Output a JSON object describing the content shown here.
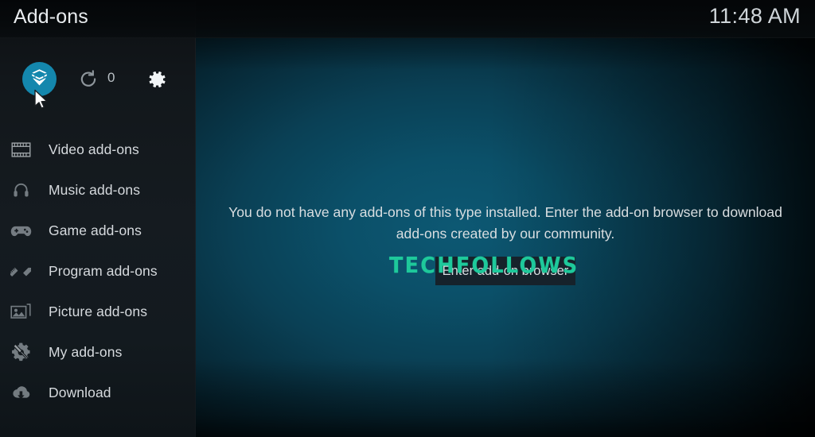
{
  "header": {
    "title": "Add-ons",
    "clock": "11:48 AM"
  },
  "toolbar": {
    "box_icon": "open-box-icon",
    "refresh_icon": "refresh-icon",
    "update_count": "0",
    "settings_icon": "gear-icon"
  },
  "sidebar": {
    "items": [
      {
        "label": "Video add-ons",
        "icon": "film-strip-icon"
      },
      {
        "label": "Music add-ons",
        "icon": "headphones-icon"
      },
      {
        "label": "Game add-ons",
        "icon": "gamepad-icon"
      },
      {
        "label": "Program add-ons",
        "icon": "pencil-ruler-icon"
      },
      {
        "label": "Picture add-ons",
        "icon": "picture-icon"
      },
      {
        "label": "My add-ons",
        "icon": "gear-screwdriver-icon"
      },
      {
        "label": "Download",
        "icon": "cloud-download-icon"
      }
    ]
  },
  "main": {
    "empty_message": "You do not have any add-ons of this type installed. Enter the add-on browser to download add-ons created by our community.",
    "browser_button": "Enter add-on browser"
  },
  "watermark": {
    "text": "TECHFOLLOWS"
  },
  "colors": {
    "accent": "#1487ad",
    "watermark": "#1ec99b",
    "sidebar_bg": "#151b20",
    "button_bg": "#16222b",
    "text": "#d9dee1"
  }
}
